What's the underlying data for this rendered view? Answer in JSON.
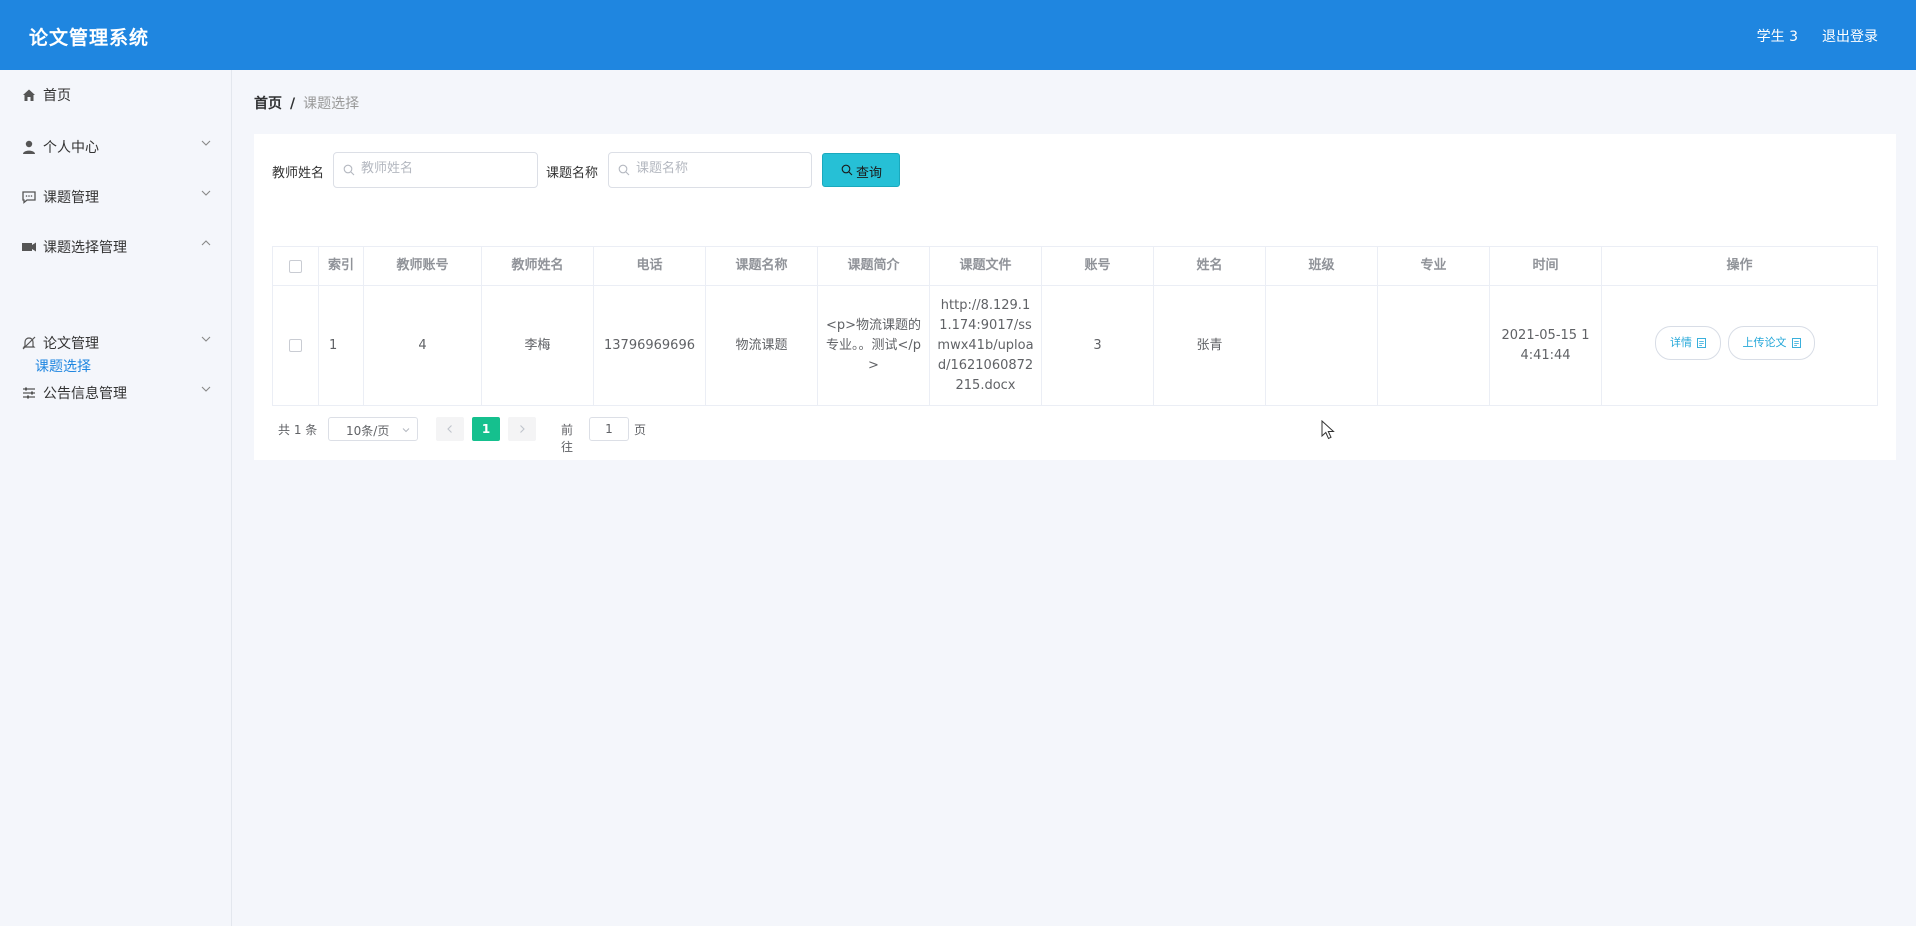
{
  "app": {
    "title": "论文管理系统"
  },
  "header": {
    "user": "学生 3",
    "logout": "退出登录"
  },
  "sidebar": {
    "items": [
      {
        "label": "首页",
        "icon": "home-icon"
      },
      {
        "label": "个人中心",
        "icon": "user-icon"
      },
      {
        "label": "课题管理",
        "icon": "chat-icon"
      },
      {
        "label": "课题选择管理",
        "icon": "ticket-icon"
      },
      {
        "label": "论文管理",
        "icon": "bell-off-icon"
      },
      {
        "label": "公告信息管理",
        "icon": "sliders-icon"
      }
    ],
    "sub_item": "课题选择"
  },
  "breadcrumb": {
    "home": "首页",
    "separator": "/",
    "current": "课题选择"
  },
  "search": {
    "teacher_label": "教师姓名",
    "teacher_placeholder": "教师姓名",
    "topic_label": "课题名称",
    "topic_placeholder": "课题名称",
    "button": "查询"
  },
  "table": {
    "headers": [
      "索引",
      "教师账号",
      "教师姓名",
      "电话",
      "课题名称",
      "课题简介",
      "课题文件",
      "账号",
      "姓名",
      "班级",
      "专业",
      "时间",
      "操作"
    ],
    "rows": [
      {
        "index": "1",
        "teacher_account": "4",
        "teacher_name": "李梅",
        "phone": "13796969696",
        "topic_name": "物流课题",
        "topic_intro": "<p>物流课题的专业。。测试</p>",
        "topic_file": "http://8.129.11.174:9017/ssmwx41b/upload/1621060872215.docx",
        "account": "3",
        "name": "张青",
        "class": "",
        "major": "",
        "time": "2021-05-15 14:41:44",
        "detail_btn": "详情",
        "upload_btn": "上传论文"
      }
    ]
  },
  "pagination": {
    "total": "共 1 条",
    "page_size": "10条/页",
    "current_page": "1",
    "goto_label": "前往",
    "goto_value": "1",
    "page_unit": "页"
  },
  "colors": {
    "header_bg": "#1f86e0",
    "search_button": "#26c0d6",
    "active_page": "#15c08e",
    "sub_item": "#1f86e0"
  }
}
